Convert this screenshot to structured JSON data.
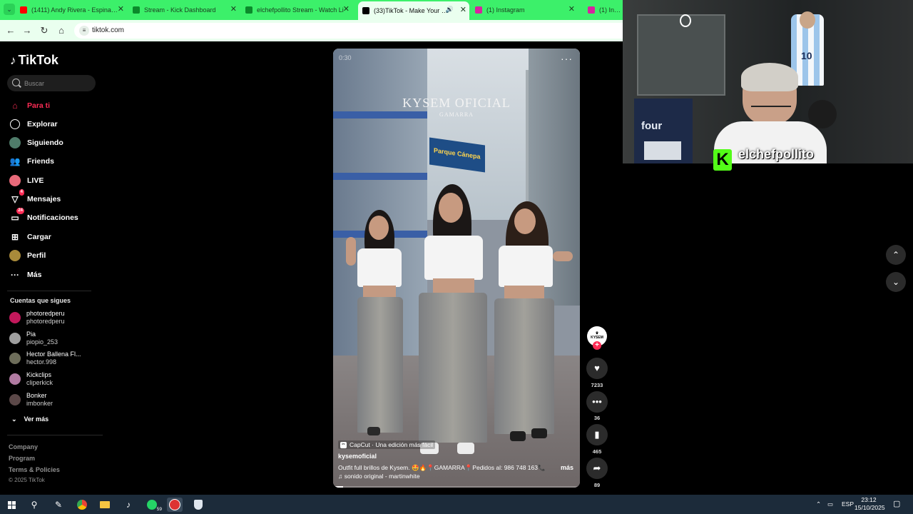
{
  "browser": {
    "tabs": [
      {
        "title": "(1411) Andy Rivera - Espina de",
        "favicon_color": "#ff0000"
      },
      {
        "title": "Stream - Kick Dashboard",
        "favicon_color": "#0b8a2b"
      },
      {
        "title": "elchefpollito Stream - Watch Li",
        "favicon_color": "#0b8a2b"
      },
      {
        "title": "(33)TikTok - Make Your Day",
        "favicon_color": "#000000",
        "active": true
      },
      {
        "title": "(1) Instagram",
        "favicon_color": "#d6249f"
      },
      {
        "title": "(1) Instag",
        "favicon_color": "#d6249f"
      }
    ],
    "url": "tiktok.com"
  },
  "sidebar": {
    "logo": "TikTok",
    "search_placeholder": "Buscar",
    "nav": [
      {
        "label": "Para ti",
        "icon": "home-icon",
        "active": true
      },
      {
        "label": "Explorar",
        "icon": "compass-icon"
      },
      {
        "label": "Siguiendo",
        "icon": "following-avatar"
      },
      {
        "label": "Friends",
        "icon": "friends-icon"
      },
      {
        "label": "LIVE",
        "icon": "live-icon"
      },
      {
        "label": "Mensajes",
        "icon": "messages-icon",
        "badge": "4"
      },
      {
        "label": "Notificaciones",
        "icon": "notifications-icon",
        "badge": "24"
      },
      {
        "label": "Cargar",
        "icon": "upload-icon"
      },
      {
        "label": "Perfil",
        "icon": "profile-avatar"
      },
      {
        "label": "Más",
        "icon": "more-icon"
      }
    ],
    "following_title": "Cuentas que sigues",
    "following": [
      {
        "name": "photoredperu",
        "handle": "photoredperu",
        "color": "#c2185b"
      },
      {
        "name": "Pia",
        "handle": "piopio_253",
        "color": "#9e9e9e"
      },
      {
        "name": "Hector Ballena Fl...",
        "handle": "hector.998",
        "color": "#6d6d5a"
      },
      {
        "name": "Kickclips",
        "handle": "cliperkick",
        "color": "#b07aa1"
      },
      {
        "name": "Bonker",
        "handle": "imbonker",
        "color": "#5b4848"
      }
    ],
    "see_more": "Ver más",
    "footer": [
      "Company",
      "Program",
      "Terms & Policies"
    ],
    "copyright": "© 2025 TikTok"
  },
  "video": {
    "time": "0:30",
    "watermark_title": "KYSEM OFICIAL",
    "watermark_sub": "GAMARRA",
    "store_sign": "Parque Cánepa",
    "capcut": "CapCut · Una edición más fácil",
    "author": "kysemoficial",
    "description": "Outfit full brillos de Kysem. 🤩🔥📍GAMARRA📍Pedidos al: 986 748 163📞 ..",
    "more": "más",
    "sound": "♫  sonido original - martinwhite",
    "progress": 0.04
  },
  "actions": {
    "creator_label": "KYSEM",
    "likes": "7233",
    "comments": "36",
    "saves": "465",
    "shares": "89"
  },
  "webcam": {
    "streamer": "elchefpollito",
    "fridge_brand": "four",
    "jersey_number": "10"
  },
  "taskbar": {
    "whatsapp_badge": "59",
    "language": "ESP",
    "time": "23:12",
    "date": "15/10/2025"
  }
}
